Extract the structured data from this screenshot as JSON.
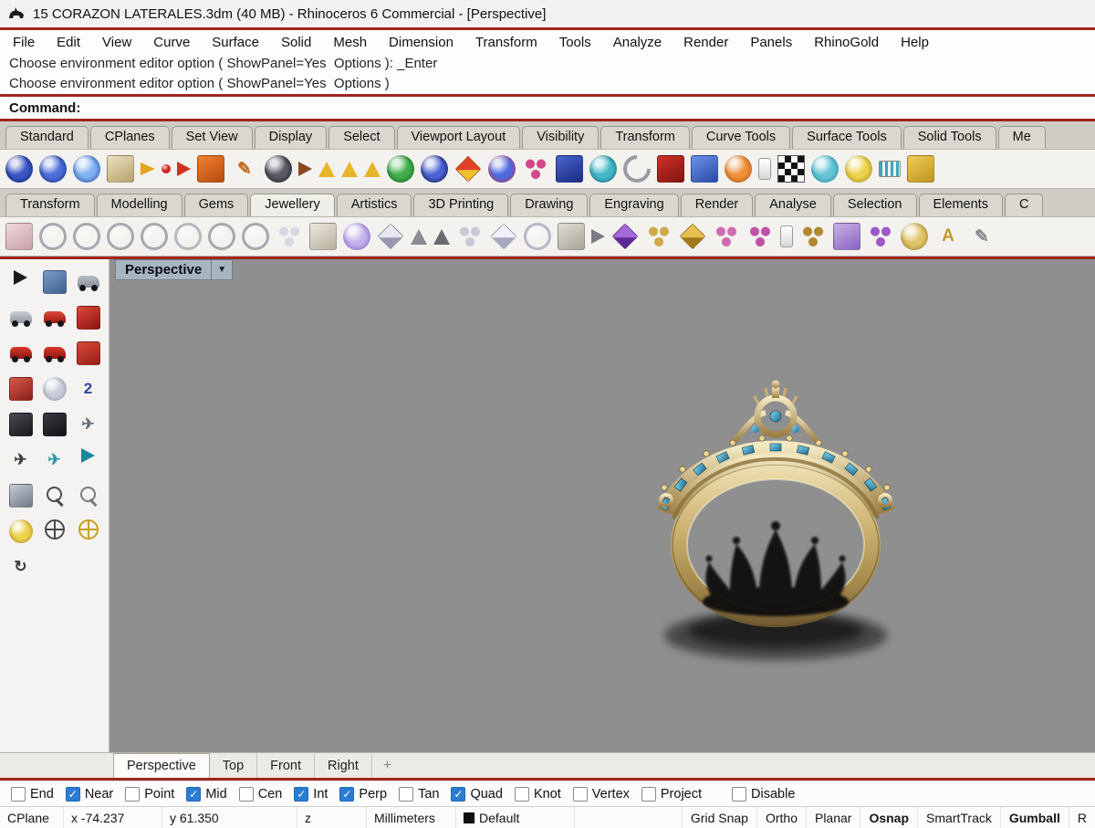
{
  "window": {
    "title": "15 CORAZON LATERALES.3dm (40 MB) - Rhinoceros 6 Commercial - [Perspective]"
  },
  "menu": {
    "items": [
      "File",
      "Edit",
      "View",
      "Curve",
      "Surface",
      "Solid",
      "Mesh",
      "Dimension",
      "Transform",
      "Tools",
      "Analyze",
      "Render",
      "Panels",
      "RhinoGold",
      "Help"
    ]
  },
  "command": {
    "line1": "Choose environment editor option ( ShowPanel=Yes  Options ): _Enter",
    "line2": "Choose environment editor option ( ShowPanel=Yes  Options )",
    "prompt": "Command:"
  },
  "tabs_row1": {
    "items": [
      {
        "name": "tab-standard",
        "label": "Standard"
      },
      {
        "name": "tab-cplanes",
        "label": "CPlanes"
      },
      {
        "name": "tab-set-view",
        "label": "Set View"
      },
      {
        "name": "tab-display",
        "label": "Display"
      },
      {
        "name": "tab-select",
        "label": "Select"
      },
      {
        "name": "tab-viewport-layout",
        "label": "Viewport Layout"
      },
      {
        "name": "tab-visibility",
        "label": "Visibility"
      },
      {
        "name": "tab-transform",
        "label": "Transform"
      },
      {
        "name": "tab-curve-tools",
        "label": "Curve Tools"
      },
      {
        "name": "tab-surface-tools",
        "label": "Surface Tools"
      },
      {
        "name": "tab-solid-tools",
        "label": "Solid Tools"
      },
      {
        "name": "tab-clipped",
        "label": "Me"
      }
    ]
  },
  "toolbar1": {
    "icons": [
      {
        "name": "shaded-sphere-icon",
        "shape": "ball",
        "c1": "#3a56c4",
        "c2": "#101d66"
      },
      {
        "name": "rendered-sphere-icon",
        "shape": "ball",
        "c1": "#4a6fd8",
        "c2": "#142a7a"
      },
      {
        "name": "glossy-sphere-icon",
        "shape": "ball",
        "c1": "#7fb0f0",
        "c2": "#1d3f9e"
      },
      {
        "name": "layer-stack-icon",
        "shape": "square",
        "c1": "#ece2c2",
        "c2": "#b5a26a"
      },
      {
        "name": "flag-icon",
        "shape": "flag",
        "c1": "#e0a81c"
      },
      {
        "name": "point-icon",
        "shape": "dot",
        "c1": "#d02418"
      },
      {
        "name": "pointer-arrow-icon",
        "shape": "coneR",
        "c1": "#d0341c"
      },
      {
        "name": "rectangle-icon",
        "shape": "square",
        "c1": "#f08030",
        "c2": "#b84c10"
      },
      {
        "name": "line-pencil-icon",
        "shape": "glyph",
        "glyph": "✎",
        "c1": "#c06a20"
      },
      {
        "name": "orbit-sphere-icon",
        "shape": "ball",
        "c1": "#5a5a66",
        "c2": "#17171f"
      },
      {
        "name": "curve-arrow-icon",
        "shape": "coneR",
        "c1": "#8a4a20"
      },
      {
        "name": "cone-analysis-icon",
        "shape": "cone",
        "c1": "#e8b428"
      },
      {
        "name": "cone-analysis2-icon",
        "shape": "cone",
        "c1": "#e8b428"
      },
      {
        "name": "cone-analysis3-icon",
        "shape": "cone",
        "c1": "#e8b428"
      },
      {
        "name": "green-sphere-icon",
        "shape": "ball",
        "c1": "#3fae4a",
        "c2": "#126023"
      },
      {
        "name": "two-tone-sphere-icon",
        "shape": "ball",
        "c1": "#4a62d8",
        "c2": "#0c1030"
      },
      {
        "name": "candy-icon",
        "shape": "gem",
        "c1": "#e04028",
        "c2": "#f0c030"
      },
      {
        "name": "globe-pair-icon",
        "shape": "ball",
        "c1": "#4a6ae0",
        "c2": "#c03050"
      },
      {
        "name": "sparkle-icon",
        "shape": "cluster",
        "c1": "#d04888"
      },
      {
        "name": "blue-cube-icon",
        "shape": "square",
        "c1": "#4a66d0",
        "c2": "#1a2a80"
      },
      {
        "name": "teal-sphere-icon",
        "shape": "ball",
        "c1": "#45b8c8",
        "c2": "#106878"
      },
      {
        "name": "metal-hook-icon",
        "shape": "halfring",
        "c1": "#9a9aa4"
      },
      {
        "name": "red-toolbox-icon",
        "shape": "square",
        "c1": "#d03028",
        "c2": "#801410"
      },
      {
        "name": "sphere-box-icon",
        "shape": "square",
        "c1": "#6a92e8",
        "c2": "#2a4aa8"
      },
      {
        "name": "orange-ball-icon",
        "shape": "ball",
        "c1": "#f09038",
        "c2": "#a05210"
      },
      {
        "name": "airbrush-icon",
        "shape": "spray",
        "c1": "#f2f2f2"
      },
      {
        "name": "checker-icon",
        "shape": "checker",
        "c1": "#000000"
      },
      {
        "name": "teal-ellipse-icon",
        "shape": "ball",
        "c1": "#62c4d4",
        "c2": "#2a8496"
      },
      {
        "name": "bulb-magnifier-icon",
        "shape": "ball",
        "c1": "#ecd24a",
        "c2": "#a08820"
      },
      {
        "name": "comb-icon",
        "shape": "comb",
        "c1": "#3aa8b8"
      },
      {
        "name": "folder-icon",
        "shape": "square",
        "c1": "#f0cc58",
        "c2": "#c09420"
      }
    ]
  },
  "tabs_row2": {
    "items": [
      {
        "name": "tab-gold-transform",
        "label": "Transform"
      },
      {
        "name": "tab-gold-modelling",
        "label": "Modelling"
      },
      {
        "name": "tab-gold-gems",
        "label": "Gems"
      },
      {
        "name": "tab-gold-jewellery",
        "label": "Jewellery",
        "active": true
      },
      {
        "name": "tab-gold-artistics",
        "label": "Artistics"
      },
      {
        "name": "tab-gold-3d-printing",
        "label": "3D Printing"
      },
      {
        "name": "tab-gold-drawing",
        "label": "Drawing"
      },
      {
        "name": "tab-gold-engraving",
        "label": "Engraving"
      },
      {
        "name": "tab-gold-render",
        "label": "Render"
      },
      {
        "name": "tab-gold-analyse",
        "label": "Analyse"
      },
      {
        "name": "tab-gold-selection",
        "label": "Selection"
      },
      {
        "name": "tab-gold-elements",
        "label": "Elements"
      },
      {
        "name": "tab-gold-clipped",
        "label": "C"
      }
    ]
  },
  "toolbar2": {
    "icons": [
      {
        "name": "ring-size-icon",
        "shape": "square",
        "c1": "#f0d8dc",
        "c2": "#c8a0a8"
      },
      {
        "name": "ring-wizard-icon",
        "shape": "ring",
        "c1": "#a8a8b0"
      },
      {
        "name": "ring-band-icon",
        "shape": "ring",
        "c1": "#a8a8b0"
      },
      {
        "name": "ring-solitaire-icon",
        "shape": "ring",
        "c1": "#a8a8b0"
      },
      {
        "name": "ring-eternity-icon",
        "shape": "ring",
        "c1": "#a8a8b0"
      },
      {
        "name": "ring-beads-icon",
        "shape": "ring",
        "c1": "#b8b8c0"
      },
      {
        "name": "ring-signet-icon",
        "shape": "ring",
        "c1": "#a8a8b0"
      },
      {
        "name": "ring-engagement-icon",
        "shape": "ring",
        "c1": "#a8a8b0"
      },
      {
        "name": "gem-cluster-icon",
        "shape": "cluster",
        "c1": "#d8d8e4"
      },
      {
        "name": "signet-top-icon",
        "shape": "square",
        "c1": "#ece8dc",
        "c2": "#b8b0a0"
      },
      {
        "name": "purple-dome-icon",
        "shape": "ball",
        "c1": "#c4b2ec",
        "c2": "#7a5ab8"
      },
      {
        "name": "diamond-icon",
        "shape": "gem",
        "c1": "#e8e8f0",
        "c2": "#9898b0"
      },
      {
        "name": "drop-arrow-icon",
        "shape": "cone",
        "c1": "#8a8a92"
      },
      {
        "name": "drop-arrow2-icon",
        "shape": "cone",
        "c1": "#6a6a72"
      },
      {
        "name": "pave-icon",
        "shape": "cluster",
        "c1": "#c8c8d4"
      },
      {
        "name": "gem-white-icon",
        "shape": "gem",
        "c1": "#f0f0f8",
        "c2": "#a8a8c0"
      },
      {
        "name": "gem-ring-icon",
        "shape": "ring",
        "c1": "#b8b8c8"
      },
      {
        "name": "bezel-icon",
        "shape": "square",
        "c1": "#e0ded4",
        "c2": "#a8a498"
      },
      {
        "name": "arrow-tool-icon",
        "shape": "coneR",
        "c1": "#7a7a82"
      },
      {
        "name": "purple-gem-icon",
        "shape": "gem",
        "c1": "#a468d8",
        "c2": "#5c2a96"
      },
      {
        "name": "pave-gold-icon",
        "shape": "cluster",
        "c1": "#d0a848"
      },
      {
        "name": "gold-gem-icon",
        "shape": "gem",
        "c1": "#e8c050",
        "c2": "#a07818"
      },
      {
        "name": "pink-cluster-icon",
        "shape": "cluster",
        "c1": "#d06ab0"
      },
      {
        "name": "magenta-cluster-icon",
        "shape": "cluster",
        "c1": "#c050a8"
      },
      {
        "name": "silver-spray-icon",
        "shape": "spray",
        "c1": "#e8e8ec"
      },
      {
        "name": "gold-cluster-icon",
        "shape": "cluster",
        "c1": "#b08830"
      },
      {
        "name": "channel-icon",
        "shape": "square",
        "c1": "#c8b2e8",
        "c2": "#8a62c0"
      },
      {
        "name": "purple-pave-icon",
        "shape": "cluster",
        "c1": "#9a58c8"
      },
      {
        "name": "gold-bead-icon",
        "shape": "ball",
        "c1": "#e0c468",
        "c2": "#957722"
      },
      {
        "name": "letter-a-icon",
        "shape": "glyph",
        "glyph": "A",
        "c1": "#c09a30"
      },
      {
        "name": "engrave-pencil-icon",
        "shape": "glyph",
        "glyph": "✎",
        "c1": "#8a8a92"
      }
    ]
  },
  "sidebar": {
    "icons": [
      {
        "name": "select-pointer-icon",
        "shape": "coneR",
        "c1": "#1a1a1a"
      },
      {
        "name": "move-view-icon",
        "shape": "square",
        "c1": "#7a9ac8",
        "c2": "#40608e"
      },
      {
        "name": "scene-forklift-icon",
        "shape": "car",
        "c1": "#b8bcc4",
        "c2": "#888e98"
      },
      {
        "name": "studio-truck-icon",
        "shape": "car",
        "c1": "#c8ccd4",
        "c2": "#9098a4"
      },
      {
        "name": "studio-car-icon",
        "shape": "car",
        "c1": "#e04838",
        "c2": "#9a1a10"
      },
      {
        "name": "battery-icon",
        "shape": "square",
        "c1": "#e04838",
        "c2": "#8a1410"
      },
      {
        "name": "car-small-icon",
        "shape": "car",
        "c1": "#d83a2a",
        "c2": "#8a1410"
      },
      {
        "name": "car-side-icon",
        "shape": "car",
        "c1": "#d83a2a",
        "c2": "#8a1410"
      },
      {
        "name": "sofa-icon",
        "shape": "square",
        "c1": "#d84838",
        "c2": "#962018"
      },
      {
        "name": "bed-icon",
        "shape": "square",
        "c1": "#d85848",
        "c2": "#8a2018"
      },
      {
        "name": "balloon-icon",
        "shape": "ball",
        "c1": "#c8ccd8",
        "c2": "#8a90a0"
      },
      {
        "name": "two-d-view-icon",
        "shape": "glyph",
        "glyph": "2",
        "c1": "#2a4a9a"
      },
      {
        "name": "table-icon",
        "shape": "square",
        "c1": "#4a4a52",
        "c2": "#17171c"
      },
      {
        "name": "chair-icon",
        "shape": "square",
        "c1": "#3a3a42",
        "c2": "#101014"
      },
      {
        "name": "plane-gray-icon",
        "shape": "glyph",
        "glyph": "✈",
        "c1": "#6a7078"
      },
      {
        "name": "plane-dark-icon",
        "shape": "glyph",
        "glyph": "✈",
        "c1": "#3a4048"
      },
      {
        "name": "plane-teal-icon",
        "shape": "glyph",
        "glyph": "✈",
        "c1": "#2a9aaa"
      },
      {
        "name": "zoom-extents-icon",
        "shape": "coneR",
        "c1": "#1a8a9a"
      },
      {
        "name": "view-cube-icon",
        "shape": "square",
        "c1": "#c8ccd4",
        "c2": "#70788a"
      },
      {
        "name": "zoom-icon",
        "shape": "magnifier",
        "c1": "#4a4a52"
      },
      {
        "name": "zoom-window-icon",
        "shape": "magnifier",
        "c1": "#7a7a84"
      },
      {
        "name": "zoom-selected-icon",
        "shape": "ball",
        "c1": "#ecd24a",
        "c2": "#a8861c"
      },
      {
        "name": "pan-crosshair-icon",
        "shape": "crosshair",
        "c1": "#4a4a52"
      },
      {
        "name": "target-icon",
        "shape": "crosshair",
        "c1": "#c8a020"
      },
      {
        "name": "rotate-view-icon",
        "shape": "glyph",
        "glyph": "↻",
        "c1": "#3a3a42"
      }
    ]
  },
  "viewport": {
    "label": "Perspective",
    "dropdown_glyph": "▼"
  },
  "viewport_tabs": {
    "items": [
      {
        "name": "vptab-perspective",
        "label": "Perspective",
        "active": true
      },
      {
        "name": "vptab-top",
        "label": "Top"
      },
      {
        "name": "vptab-front",
        "label": "Front"
      },
      {
        "name": "vptab-right",
        "label": "Right"
      }
    ],
    "add_glyph": "+"
  },
  "osnap": {
    "items": [
      {
        "name": "osnap-end",
        "label": "End",
        "checked": false
      },
      {
        "name": "osnap-near",
        "label": "Near",
        "checked": true
      },
      {
        "name": "osnap-point",
        "label": "Point",
        "checked": false
      },
      {
        "name": "osnap-mid",
        "label": "Mid",
        "checked": true
      },
      {
        "name": "osnap-cen",
        "label": "Cen",
        "checked": false
      },
      {
        "name": "osnap-int",
        "label": "Int",
        "checked": true
      },
      {
        "name": "osnap-perp",
        "label": "Perp",
        "checked": true
      },
      {
        "name": "osnap-tan",
        "label": "Tan",
        "checked": false
      },
      {
        "name": "osnap-quad",
        "label": "Quad",
        "checked": true
      },
      {
        "name": "osnap-knot",
        "label": "Knot",
        "checked": false
      },
      {
        "name": "osnap-vertex",
        "label": "Vertex",
        "checked": false
      },
      {
        "name": "osnap-project",
        "label": "Project",
        "checked": false
      },
      {
        "name": "osnap-disable",
        "label": "Disable",
        "checked": false
      }
    ]
  },
  "statusbar": {
    "cplane": "CPlane",
    "x": "x -74.237",
    "y": "y 61.350",
    "z": "z",
    "units": "Millimeters",
    "layer": "Default",
    "toggles": [
      {
        "name": "status-grid-snap",
        "label": "Grid Snap"
      },
      {
        "name": "status-ortho",
        "label": "Ortho"
      },
      {
        "name": "status-planar",
        "label": "Planar"
      },
      {
        "name": "status-osnap",
        "label": "Osnap",
        "bold": true
      },
      {
        "name": "status-smarttrack",
        "label": "SmartTrack"
      },
      {
        "name": "status-gumball",
        "label": "Gumball",
        "bold": true
      },
      {
        "name": "status-clipped",
        "label": "R"
      }
    ]
  },
  "colors": {
    "divider_red": "#a1251b",
    "viewport_gray": "#8f8f8f",
    "checkbox_blue": "#2b7cd3",
    "gold": "#cdb272",
    "gem_blue": "#3f9fc6"
  }
}
